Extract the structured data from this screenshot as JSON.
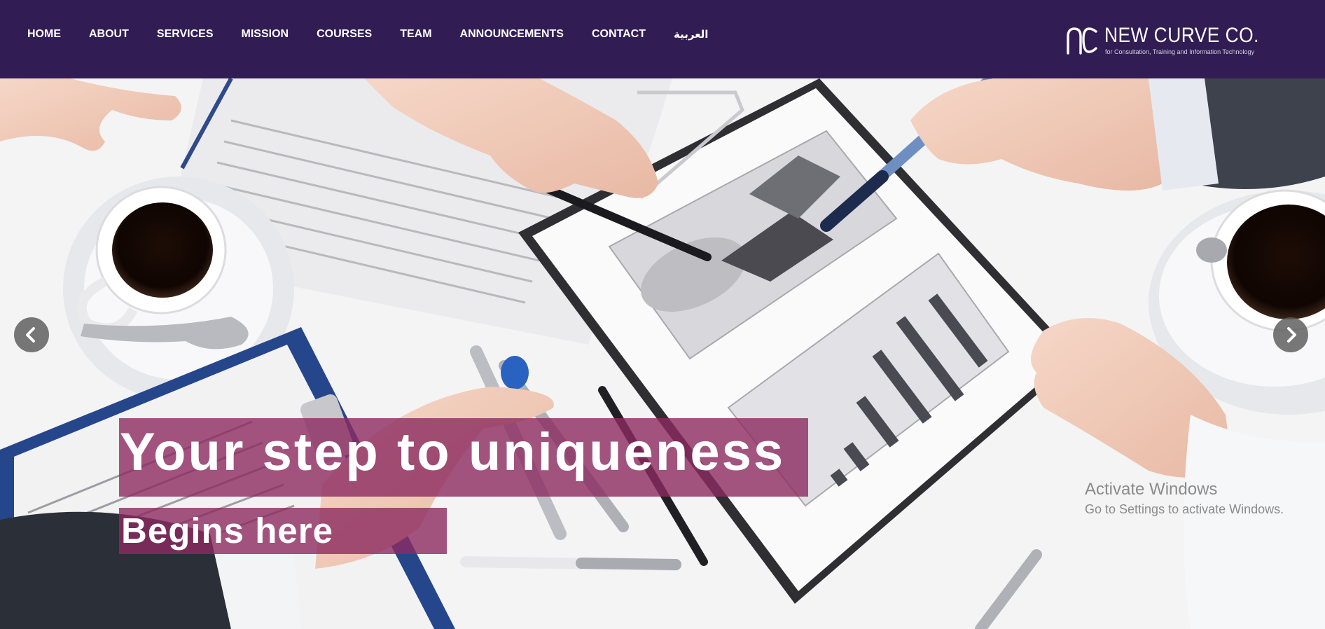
{
  "nav": {
    "items": [
      {
        "label": "HOME"
      },
      {
        "label": "ABOUT"
      },
      {
        "label": "SERVICES"
      },
      {
        "label": "MISSION"
      },
      {
        "label": "COURSES"
      },
      {
        "label": "TEAM"
      },
      {
        "label": "ANNOUNCEMENTS"
      },
      {
        "label": "CONTACT"
      },
      {
        "label": "العربية"
      }
    ]
  },
  "logo": {
    "name": "NEW CURVE CO.",
    "tagline": "for Consultation, Training and Information Technology"
  },
  "hero": {
    "headline": "Your step to uniqueness",
    "subheadline": "Begins here",
    "prev_icon": "chevron-left-icon",
    "next_icon": "chevron-right-icon"
  },
  "watermark": {
    "title": "Activate Windows",
    "subtitle": "Go to Settings to activate Windows."
  },
  "colors": {
    "navbar": "#311d53",
    "overlay": "#8c2a60",
    "text": "#ffffff"
  }
}
